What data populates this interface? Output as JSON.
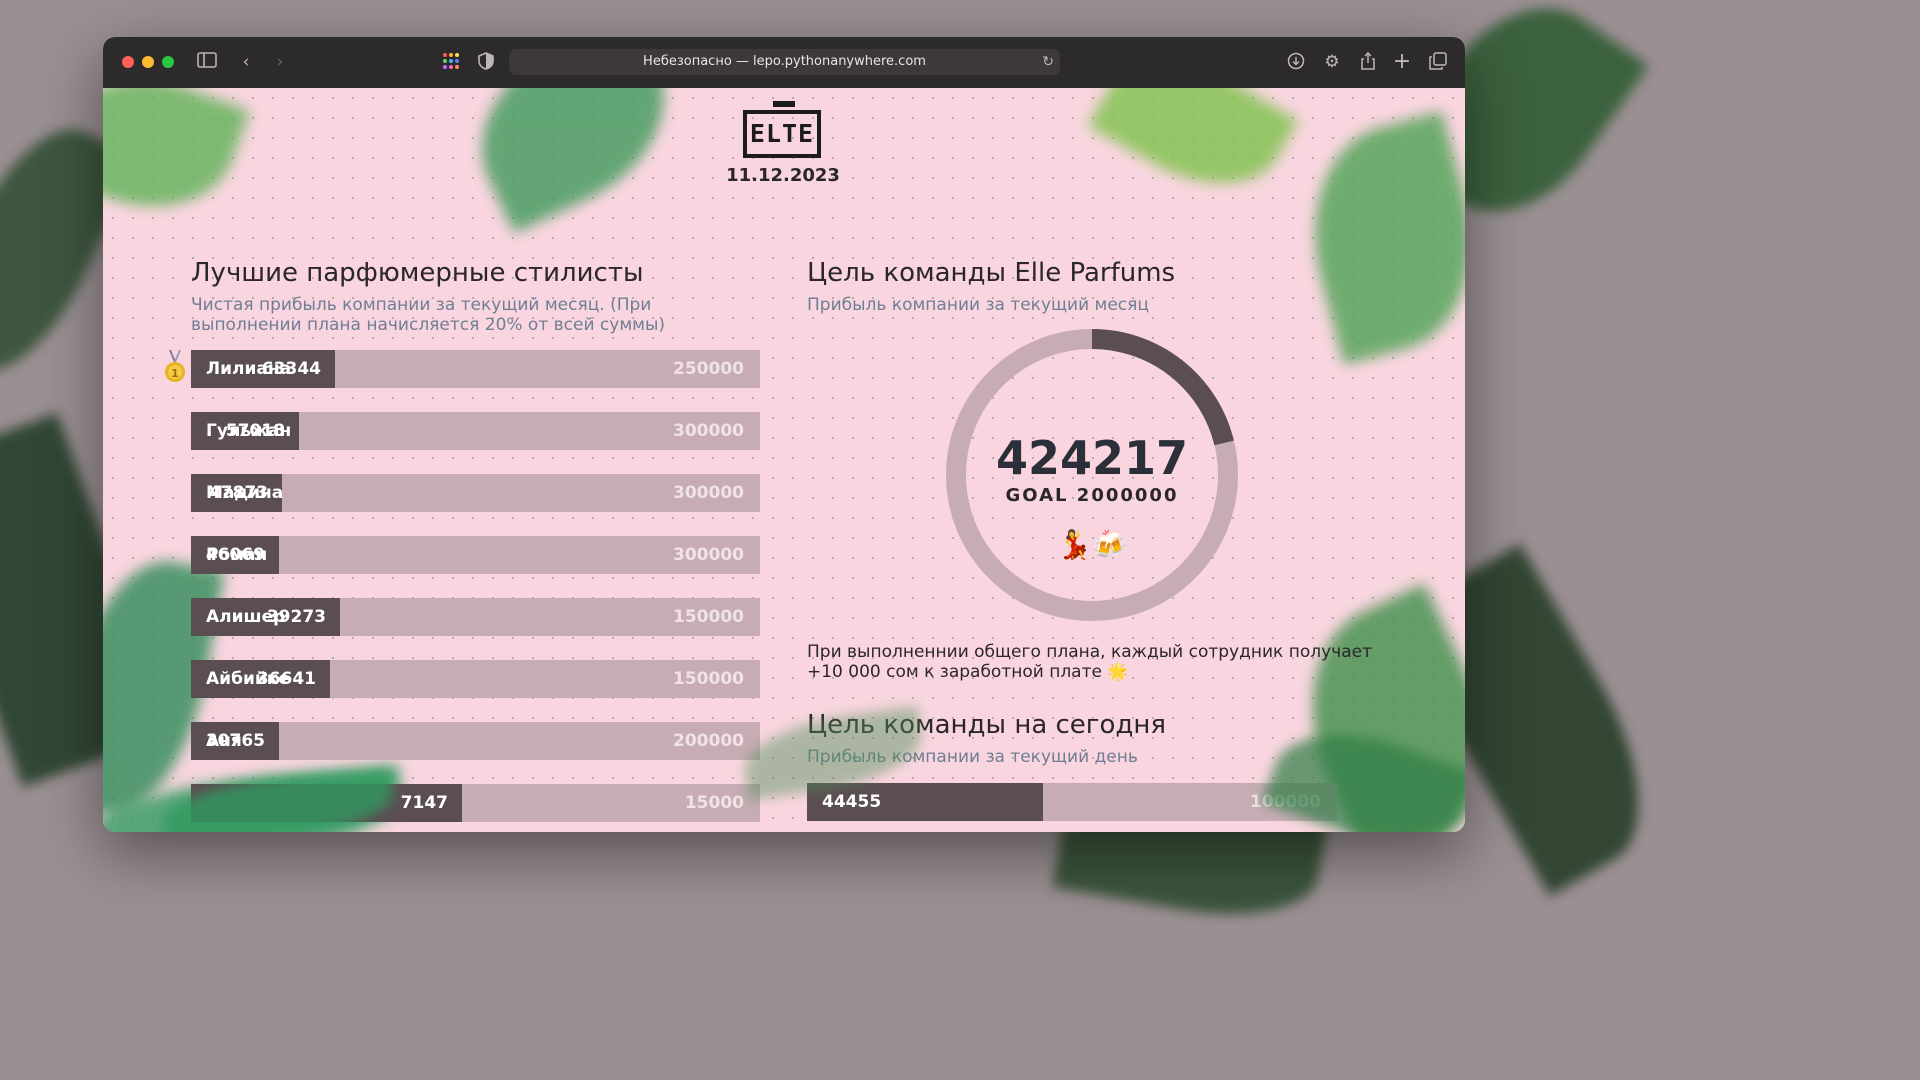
{
  "browser": {
    "url_text": "Небезопасно — lepo.pythonanywhere.com"
  },
  "header": {
    "logo_text": "ELTE",
    "date": "11.12.2023"
  },
  "stylists": {
    "title": "Лучшие парфюмерные стилисты",
    "subtitle": "Чистая прибыль компании за текущий месяц. (При выполнении плана начисляется 20% от всей суммы)",
    "rows": [
      {
        "name": "Лилиана",
        "value": "63344",
        "goal": "250000",
        "progress": 0.253
      },
      {
        "name": "Гульжан",
        "value": "57018",
        "goal": "300000",
        "progress": 0.19
      },
      {
        "name": "Мадина",
        "value": "47873",
        "goal": "300000",
        "progress": 0.16
      },
      {
        "name": "Роман",
        "value": "46069",
        "goal": "300000",
        "progress": 0.154
      },
      {
        "name": "Алишер",
        "value": "39273",
        "goal": "150000",
        "progress": 0.262
      },
      {
        "name": "Айбийке",
        "value": "36641",
        "goal": "150000",
        "progress": 0.244
      },
      {
        "name": "Аня",
        "value": "30765",
        "goal": "200000",
        "progress": 0.154
      },
      {
        "name": "",
        "value": "7147",
        "goal": "15000",
        "progress": 0.476
      }
    ]
  },
  "team_goal": {
    "title": "Цель команды Elle Parfums",
    "subtitle": "Прибыль компании за текущий месяц",
    "current": "424217",
    "goal_label": "GOAL 2000000",
    "progress": 0.212,
    "emoji": "💃🍻",
    "bonus_text": "При выполненнии общего плана, каждый сотрудник получает +10 000 сом к заработной плате 🌟"
  },
  "today_goal": {
    "title": "Цель команды на сегодня",
    "subtitle": "Прибыль компании за текущий день",
    "value": "44455",
    "goal": "100000",
    "progress": 0.445
  },
  "colors": {
    "page_bg": "#f9d6df",
    "bar_fill": "#5b4e52",
    "bar_track": "#c8acb4",
    "subtitle": "#6f7e94"
  }
}
